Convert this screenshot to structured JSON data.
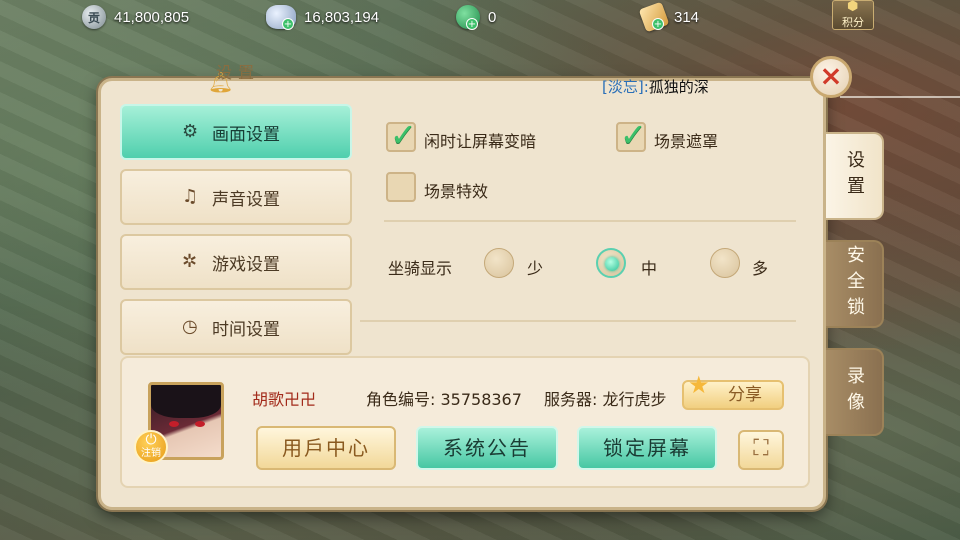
{
  "resources": [
    {
      "icon": "copper-coin-icon",
      "value": "41,800,805"
    },
    {
      "icon": "silver-ingot-icon",
      "value": "16,803,194"
    },
    {
      "icon": "jade-icon",
      "value": "0"
    },
    {
      "icon": "ticket-icon",
      "value": "314"
    }
  ],
  "points_button": "积分",
  "panel": {
    "title": "设置",
    "chat": {
      "tag": "[淡忘]:",
      "text": "孤独的深"
    }
  },
  "menu": [
    {
      "label": "画面设置",
      "icon": "screen-settings-icon",
      "active": true
    },
    {
      "label": "声音设置",
      "icon": "music-note-icon",
      "active": false
    },
    {
      "label": "游戏设置",
      "icon": "gear-icon",
      "active": false
    },
    {
      "label": "时间设置",
      "icon": "clock-icon",
      "active": false
    }
  ],
  "options": {
    "dim_when_idle": {
      "label": "闲时让屏幕变暗",
      "checked": true
    },
    "scene_occlusion": {
      "label": "场景遮罩",
      "checked": true
    },
    "scene_effects": {
      "label": "场景特效",
      "checked": false
    },
    "mount_display": {
      "label": "坐骑显示",
      "choices": [
        "少",
        "中",
        "多"
      ],
      "selected": "中"
    }
  },
  "player": {
    "name": "胡歌卍卍",
    "role_id": "角色编号: 35758367",
    "server": "服务器: 龙行虎步",
    "logout_label": "注销"
  },
  "buttons": {
    "share": "分享",
    "user_center": "用戶中心",
    "announcement": "系统公告",
    "lock_screen": "锁定屏幕"
  },
  "tabs": [
    {
      "label": "设置",
      "active": true
    },
    {
      "label": "安全锁",
      "active": false
    },
    {
      "label": "录像",
      "active": false
    }
  ],
  "colors": {
    "active_teal": "#4fcfad",
    "check_green": "#3cc06a",
    "close_red": "#d13a2a",
    "player_name": "#a22a1a"
  }
}
